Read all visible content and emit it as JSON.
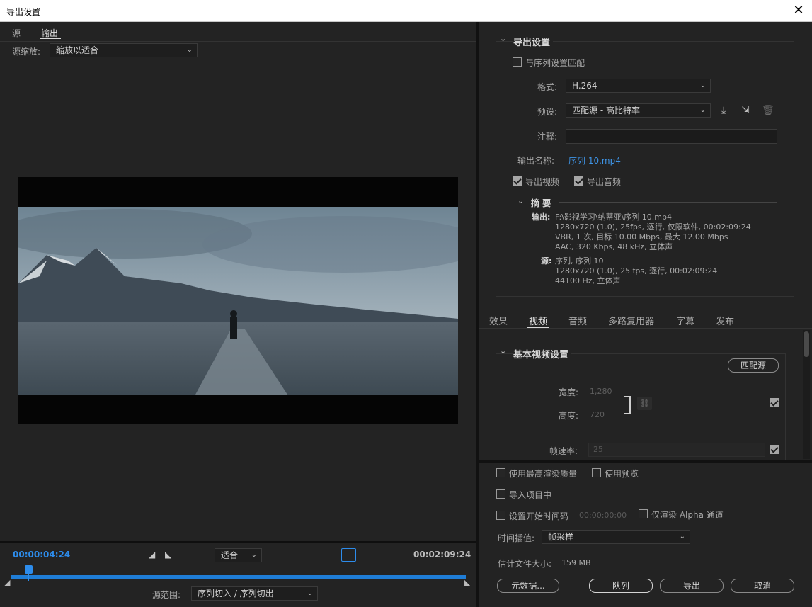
{
  "window": {
    "title": "导出设置",
    "close_glyph": "✕"
  },
  "left": {
    "tabs": [
      "源",
      "输出"
    ],
    "active_tab": "输出",
    "source_zoom_label": "源缩放:",
    "source_zoom_value": "缩放以适合",
    "current_timecode": "00:00:04:24",
    "end_timecode": "00:02:09:24",
    "fit_value": "适合",
    "source_range_label": "源范围:",
    "source_range_value": "序列切入 / 序列切出",
    "playhead_fraction": 0.035
  },
  "export_settings": {
    "header": "导出设置",
    "match_sequence_label": "与序列设置匹配",
    "match_sequence_checked": false,
    "format_label": "格式:",
    "format_value": "H.264",
    "preset_label": "预设:",
    "preset_value": "匹配源 - 高比特率",
    "comment_label": "注释:",
    "comment_value": "",
    "output_name_label": "输出名称:",
    "output_name_value": "序列 10.mp4",
    "export_video_label": "导出视频",
    "export_video_checked": true,
    "export_audio_label": "导出音频",
    "export_audio_checked": true,
    "summary_header": "摘 要",
    "output_label": "输出:",
    "output_lines": [
      "F:\\影视学习\\纳蒂亚\\序列 10.mp4",
      "1280x720 (1.0), 25fps, 逐行, 仅限软件, 00:02:09:24",
      "VBR, 1 次, 目标 10.00 Mbps, 最大 12.00 Mbps",
      "AAC, 320 Kbps, 48 kHz, 立体声"
    ],
    "source_label": "源:",
    "source_lines": [
      "序列, 序列 10",
      "1280x720 (1.0), 25 fps, 逐行, 00:02:09:24",
      "44100 Hz, 立体声"
    ]
  },
  "settings_tabs": {
    "items": [
      "效果",
      "视频",
      "音频",
      "多路复用器",
      "字幕",
      "发布"
    ],
    "active": "视频"
  },
  "basic_video": {
    "header": "基本视频设置",
    "match_source_button": "匹配源",
    "width_label": "宽度:",
    "width_value": "1,280",
    "height_label": "高度:",
    "height_value": "720",
    "frame_rate_label": "帧速率:",
    "frame_rate_value": "25",
    "width_checked": true,
    "frame_rate_checked": true
  },
  "bottom": {
    "max_render_quality_label": "使用最高渲染质量",
    "use_previews_label": "使用预览",
    "import_into_project_label": "导入项目中",
    "set_start_timecode_label": "设置开始时间码",
    "start_timecode_value": "00:00:00:00",
    "render_alpha_only_label": "仅渲染 Alpha 通道",
    "time_interpolation_label": "时间插值:",
    "time_interpolation_value": "帧采样",
    "estimated_size_label": "估计文件大小:",
    "estimated_size_value": "159 MB",
    "metadata_button": "元数据...",
    "queue_button": "队列",
    "export_button": "导出",
    "cancel_button": "取消"
  },
  "colors": {
    "accent_blue": "#2d8ceb",
    "background": "#232323",
    "timeline_bar": "#1f7dd6"
  }
}
